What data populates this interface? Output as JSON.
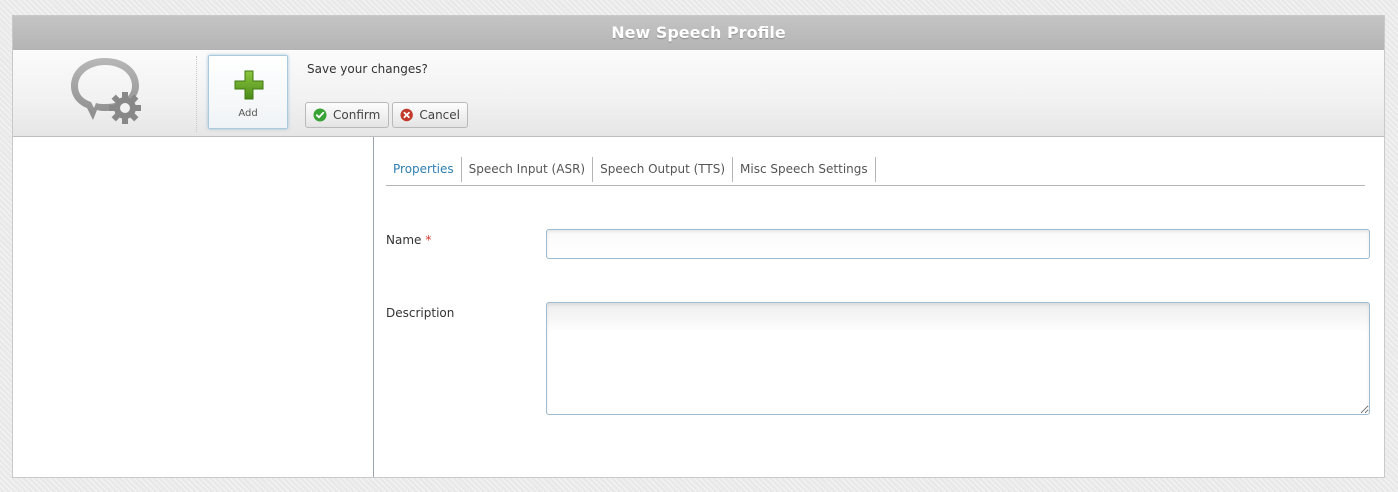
{
  "window": {
    "title": "New Speech Profile"
  },
  "toolbar": {
    "logo_icon": "speech-bubble-gear-icon",
    "add_label": "Add",
    "add_icon": "plus-icon",
    "save_prompt": "Save your changes?",
    "confirm_label": "Confirm",
    "confirm_icon": "check-circle-icon",
    "cancel_label": "Cancel",
    "cancel_icon": "x-circle-icon"
  },
  "tabs": [
    {
      "label": "Properties",
      "active": true
    },
    {
      "label": "Speech Input (ASR)",
      "active": false
    },
    {
      "label": "Speech Output (TTS)",
      "active": false
    },
    {
      "label": "Misc Speech Settings",
      "active": false
    }
  ],
  "form": {
    "name_label": "Name",
    "name_required_marker": "*",
    "name_value": "",
    "description_label": "Description",
    "description_value": ""
  },
  "colors": {
    "title_bar": "#bdbdbd",
    "active_tab": "#2e7fb0",
    "required": "#d9352b",
    "confirm_icon": "#3aa335",
    "cancel_icon": "#c0392b",
    "add_icon": "#5a9e1e"
  }
}
